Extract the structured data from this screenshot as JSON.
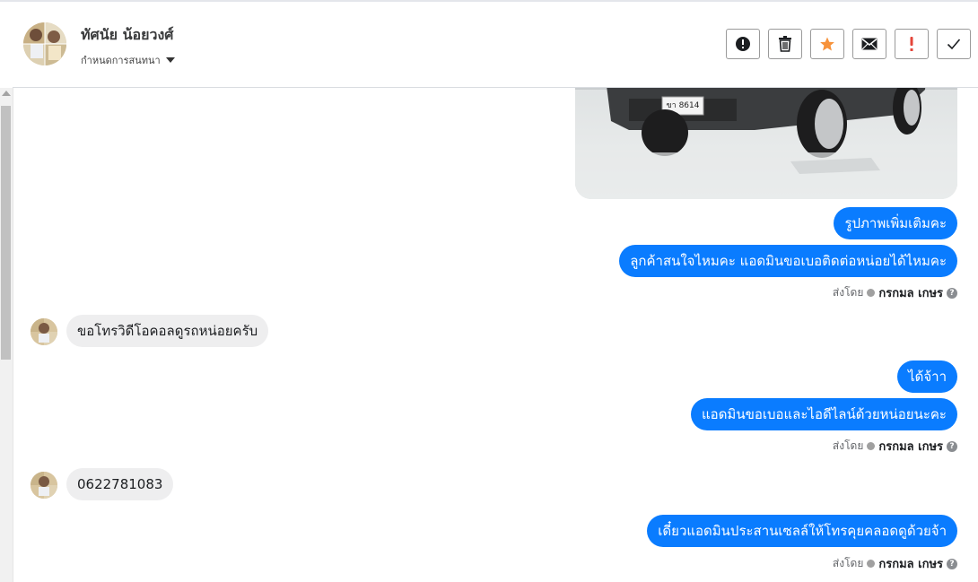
{
  "header": {
    "contact_name": "ทัศนัย น้อยวงศ์",
    "assign_label": "กำหนดการสนทนา",
    "actions": [
      {
        "icon": "alert-circle-icon"
      },
      {
        "icon": "trash-icon"
      },
      {
        "icon": "star-icon"
      },
      {
        "icon": "envelope-icon"
      },
      {
        "icon": "exclamation-icon"
      },
      {
        "icon": "check-icon"
      }
    ]
  },
  "messages": {
    "out1": "รูปภาพเพิ่มเติมคะ",
    "out2": "ลูกค้าสนใจไหมคะ แอดมินขอเบอติดต่อหน่อยได้ไหมคะ",
    "in1": "ขอโทรวิดีโอคอลดูรถหน่อยครับ",
    "out3": "ได้จ้าา",
    "out4": "แอดมินขอเบอและไอดีไลน์ด้วยหน่อยนะคะ",
    "in2": "0622781083",
    "out5": "เดี๋ยวแอดมินประสานเซลล์ให้โทรคุยคลอดดูด้วยจ้า"
  },
  "sent_by": {
    "prefix": "ส่งโดย",
    "agent": "กรกมล เกษร"
  },
  "car_plate": "ขา 8614",
  "colors": {
    "outgoing_bubble": "#0a7cff",
    "incoming_bubble": "#eeeeef",
    "star": "#f7923a",
    "exclamation": "#e4453a"
  }
}
